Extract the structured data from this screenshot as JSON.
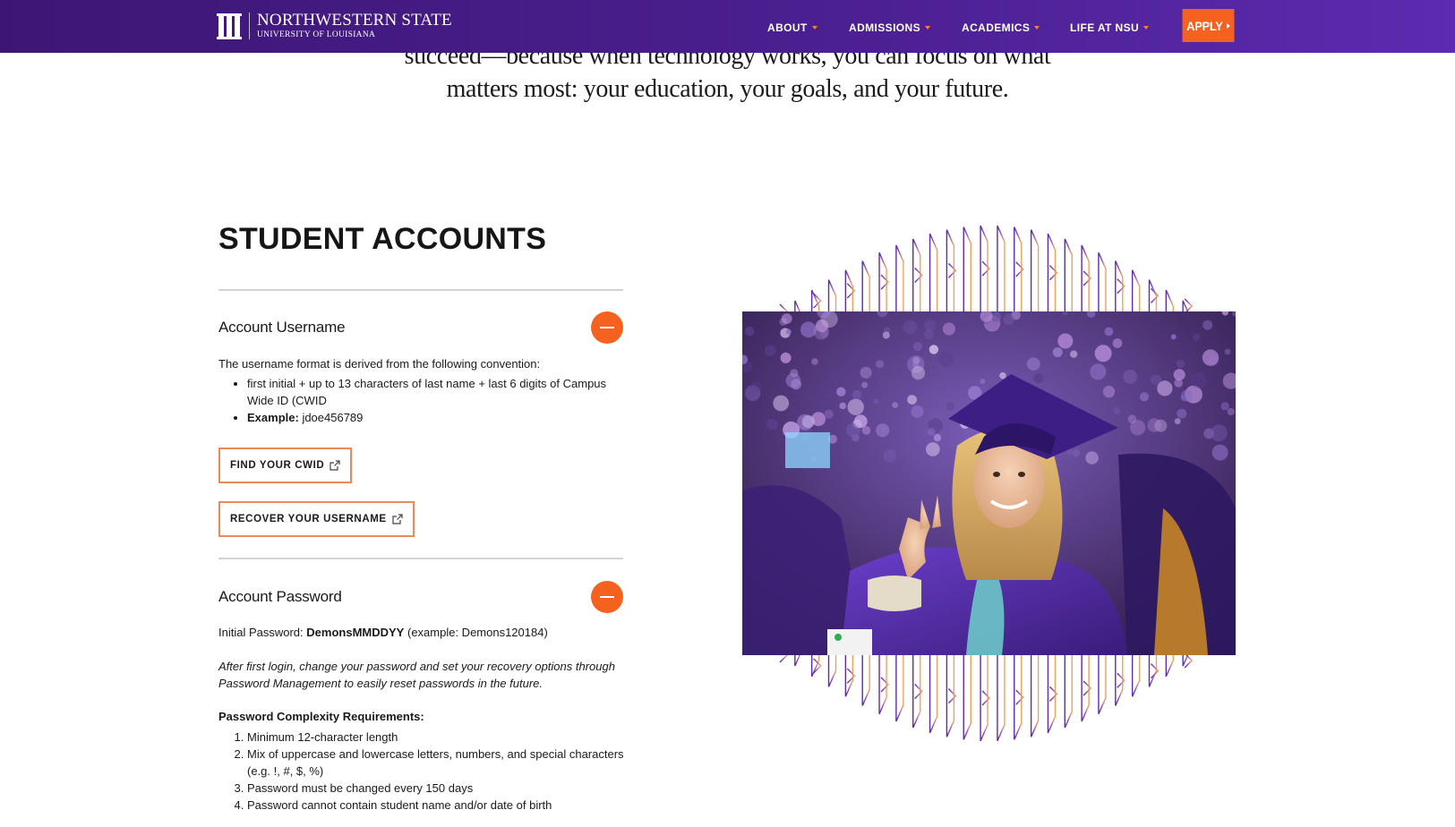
{
  "header": {
    "logo_title": "NORTHWESTERN STATE",
    "logo_subtitle": "UNIVERSITY OF LOUISIANA",
    "nav": [
      {
        "label": "ABOUT"
      },
      {
        "label": "ADMISSIONS"
      },
      {
        "label": "ACADEMICS"
      },
      {
        "label": "LIFE AT NSU"
      }
    ],
    "apply_label": "APPLY"
  },
  "intro": {
    "line1": "succeed—because when technology works, you can focus on what",
    "line2": "matters most: your education, your goals, and your future."
  },
  "section": {
    "title": "STUDENT ACCOUNTS",
    "username": {
      "title": "Account Username",
      "lead": "The username format is derived from the following convention:",
      "bullet1": "first initial + up to 13 characters of last name + last 6 digits of Campus Wide ID (CWID",
      "bullet2_label": "Example:",
      "bullet2_value": "jdoe456789",
      "find_cwid_label": "FIND YOUR CWID",
      "recover_label": "RECOVER YOUR USERNAME"
    },
    "password": {
      "title": "Account Password",
      "initial_prefix": "Initial Password:",
      "initial_value": "DemonsMMDDYY",
      "initial_example": "(example: Demons120184)",
      "note": "After first login, change your password and set your recovery options through Password Management to easily reset passwords in the future.",
      "requirements_title": "Password Complexity Requirements:",
      "requirements": [
        "Minimum 12-character length",
        "Mix of uppercase and lowercase letters, numbers, and special characters (e.g. !, #, $, %)",
        "Password must be changed every 150 days",
        "Password cannot contain student name and/or date of birth"
      ]
    }
  },
  "colors": {
    "purple": "#4a1f8f",
    "orange": "#f5621f"
  }
}
